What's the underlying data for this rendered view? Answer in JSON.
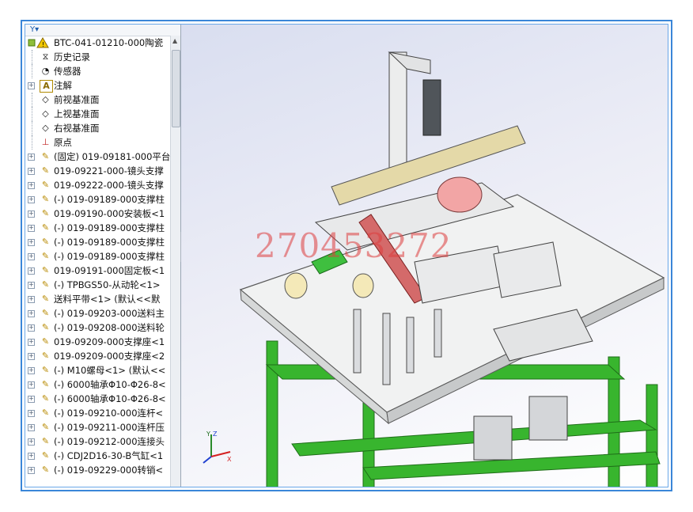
{
  "tree": {
    "filter_icon": "Y▾",
    "root": {
      "label": "BTC-041-01210-000陶瓷",
      "icon": "assembly-warning-icon"
    },
    "items": [
      {
        "label": "历史记录",
        "icon": "history-icon"
      },
      {
        "label": "传感器",
        "icon": "sensor-icon"
      },
      {
        "label": "注解",
        "icon": "annotation-icon",
        "expander": "+"
      },
      {
        "label": "前视基准面",
        "icon": "plane-icon"
      },
      {
        "label": "上视基准面",
        "icon": "plane-icon"
      },
      {
        "label": "右视基准面",
        "icon": "plane-icon"
      },
      {
        "label": "原点",
        "icon": "origin-icon"
      },
      {
        "label": "(固定) 019-09181-000平台",
        "icon": "part-icon",
        "expander": "+"
      },
      {
        "label": "019-09221-000-镜头支撑",
        "icon": "part-icon",
        "expander": "+"
      },
      {
        "label": "019-09222-000-镜头支撑",
        "icon": "part-icon",
        "expander": "+"
      },
      {
        "label": "(-) 019-09189-000支撑柱",
        "icon": "part-icon",
        "expander": "+"
      },
      {
        "label": "019-09190-000安装板<1",
        "icon": "part-icon",
        "expander": "+"
      },
      {
        "label": "(-) 019-09189-000支撑柱",
        "icon": "part-icon",
        "expander": "+"
      },
      {
        "label": "(-) 019-09189-000支撑柱",
        "icon": "part-icon",
        "expander": "+"
      },
      {
        "label": "(-) 019-09189-000支撑柱",
        "icon": "part-icon",
        "expander": "+"
      },
      {
        "label": "019-09191-000固定板<1",
        "icon": "part-icon",
        "expander": "+"
      },
      {
        "label": "(-) TPBGS50-从动轮<1>",
        "icon": "part-icon",
        "expander": "+"
      },
      {
        "label": "送料平带<1> (默认<<默",
        "icon": "part-icon",
        "expander": "+"
      },
      {
        "label": "(-) 019-09203-000送料主",
        "icon": "part-icon",
        "expander": "+"
      },
      {
        "label": "(-) 019-09208-000送料轮",
        "icon": "part-icon",
        "expander": "+"
      },
      {
        "label": "019-09209-000支撑座<1",
        "icon": "part-icon",
        "expander": "+"
      },
      {
        "label": "019-09209-000支撑座<2",
        "icon": "part-icon",
        "expander": "+"
      },
      {
        "label": "(-) M10螺母<1> (默认<<",
        "icon": "part-icon",
        "expander": "+"
      },
      {
        "label": "(-) 6000轴承Φ10-Φ26-8<",
        "icon": "part-icon",
        "expander": "+"
      },
      {
        "label": "(-) 6000轴承Φ10-Φ26-8<",
        "icon": "part-icon",
        "expander": "+"
      },
      {
        "label": "(-) 019-09210-000连杆<",
        "icon": "part-icon",
        "expander": "+"
      },
      {
        "label": "(-) 019-09211-000连杆压",
        "icon": "part-icon",
        "expander": "+"
      },
      {
        "label": "(-) 019-09212-000连接头",
        "icon": "part-icon",
        "expander": "+"
      },
      {
        "label": "(-) CDJ2D16-30-B气缸<1",
        "icon": "part-icon",
        "expander": "+"
      },
      {
        "label": "(-) 019-09229-000转销<",
        "icon": "part-icon",
        "expander": "+"
      }
    ]
  },
  "viewport": {
    "watermark": "270453272",
    "triad": {
      "x": "X",
      "y": "Y",
      "z": "Z"
    }
  },
  "colors": {
    "frame": "#3a86d8",
    "frame_green": "#33b02c",
    "table_top": "#f1f2f2",
    "tan": "#e4d9a8",
    "red_rail": "#d46a6a",
    "pink_drum": "#f2a5a5"
  }
}
